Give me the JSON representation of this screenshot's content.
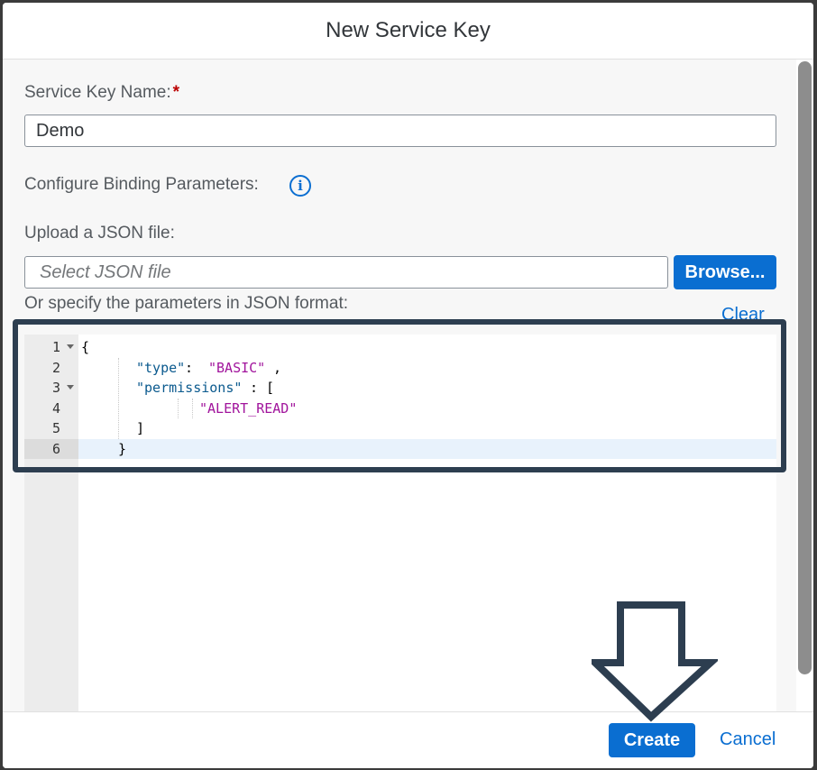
{
  "dialog": {
    "title": "New Service Key"
  },
  "form": {
    "service_key_label": "Service Key Name:",
    "required_marker": "*",
    "service_key_value": "Demo",
    "binding_label": "Configure Binding Parameters:",
    "upload_label": "Upload a JSON file:",
    "file_placeholder": "Select JSON file",
    "browse_label": "Browse...",
    "json_label": "Or specify the parameters in JSON format:",
    "clear_label": "Clear"
  },
  "editor": {
    "line_numbers": [
      "1",
      "2",
      "3",
      "4",
      "5",
      "6"
    ],
    "active_line": 6,
    "lines": {
      "l1_brace": "{",
      "l2_key": "\"type\"",
      "l2_colon": ": ",
      "l2_value": "\"BASIC\"",
      "l2_comma": ",",
      "l3_key": "\"permissions\"",
      "l3_colon": ": [",
      "l4_value": "\"ALERT_READ\"",
      "l5_bracket": "]",
      "l6_brace": "}"
    }
  },
  "footer": {
    "create_label": "Create",
    "cancel_label": "Cancel"
  },
  "icons": {
    "info": "info-icon",
    "fold": "fold-arrow-icon",
    "annotation_arrow": "down-arrow-icon"
  },
  "colors": {
    "accent": "#0a6ed1",
    "required": "#bb0000",
    "annotation": "#2d3e50",
    "string": "#a1149c",
    "key": "#0b5a8e"
  }
}
